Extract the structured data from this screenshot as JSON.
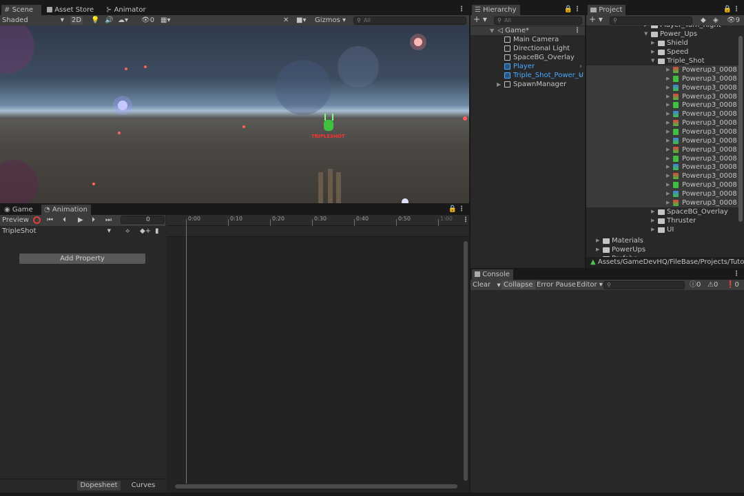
{
  "scene_panel": {
    "tabs": [
      {
        "label": "Scene",
        "icon": "hash-icon"
      },
      {
        "label": "Asset Store",
        "icon": "bag-icon"
      },
      {
        "label": "Animator",
        "icon": "animator-icon"
      }
    ],
    "shading_mode": "Shaded",
    "mode_2d": "2D",
    "hidden_count": "0",
    "gizmos": "Gizmos",
    "search_placeholder": "All",
    "overlay_text": "TRIPLESHOT"
  },
  "hierarchy": {
    "tab": "Hierarchy",
    "search_placeholder": "All",
    "scene_name": "Game*",
    "items": [
      {
        "label": "Main Camera",
        "color": "#c4c4c4"
      },
      {
        "label": "Directional Light",
        "color": "#c4c4c4"
      },
      {
        "label": "SpaceBG_Overlay",
        "color": "#c4c4c4"
      },
      {
        "label": "Player",
        "color": "#4aa8ff"
      },
      {
        "label": "Triple_Shot_Power_U",
        "color": "#4aa8ff"
      },
      {
        "label": "SpawnManager",
        "color": "#c4c4c4"
      }
    ]
  },
  "project": {
    "tab": "Project",
    "hidden_count": "9",
    "folders_top": [
      {
        "label": "Player_Turn_Right",
        "indent": 1,
        "open": false
      },
      {
        "label": "Power_Ups",
        "indent": 1,
        "open": true
      },
      {
        "label": "Shield",
        "indent": 2,
        "open": false
      },
      {
        "label": "Speed",
        "indent": 2,
        "open": false
      },
      {
        "label": "Triple_Shot",
        "indent": 2,
        "open": true
      }
    ],
    "sprites": [
      "Powerup3_0008",
      "Powerup3_0008",
      "Powerup3_0008",
      "Powerup3_0008",
      "Powerup3_0008",
      "Powerup3_0008",
      "Powerup3_0008",
      "Powerup3_0008",
      "Powerup3_0008",
      "Powerup3_0008",
      "Powerup3_0008",
      "Powerup3_0008",
      "Powerup3_0008",
      "Powerup3_0008",
      "Powerup3_0008",
      "Powerup3_0008"
    ],
    "folders_bottom": [
      {
        "label": "SpaceBG_Overlay",
        "indent": 1
      },
      {
        "label": "Thruster",
        "indent": 1
      },
      {
        "label": "UI",
        "indent": 1
      },
      {
        "label": "Materials",
        "indent": 0
      },
      {
        "label": "PowerUps",
        "indent": 0
      },
      {
        "label": "Prefabs",
        "indent": 0
      }
    ],
    "path": "Assets/GameDevHQ/FileBase/Projects/Tutoria"
  },
  "game_panel": {
    "tabs": [
      {
        "label": "Game",
        "icon": "gamepad-icon"
      },
      {
        "label": "Animation",
        "icon": "clock-icon"
      }
    ]
  },
  "animation": {
    "preview_label": "Preview",
    "frame": "0",
    "clip": "TripleShot",
    "add_property": "Add Property",
    "timeline_ticks": [
      "0:00",
      "0:10",
      "0:20",
      "0:30",
      "0:40",
      "0:50",
      "1:00"
    ],
    "bottom_tabs": [
      "Dopesheet",
      "Curves"
    ]
  },
  "console": {
    "tab": "Console",
    "clear": "Clear",
    "collapse": "Collapse",
    "error_pause": "Error Pause",
    "editor": "Editor",
    "counts": {
      "log": "0",
      "warning": "0",
      "error": "0"
    }
  }
}
